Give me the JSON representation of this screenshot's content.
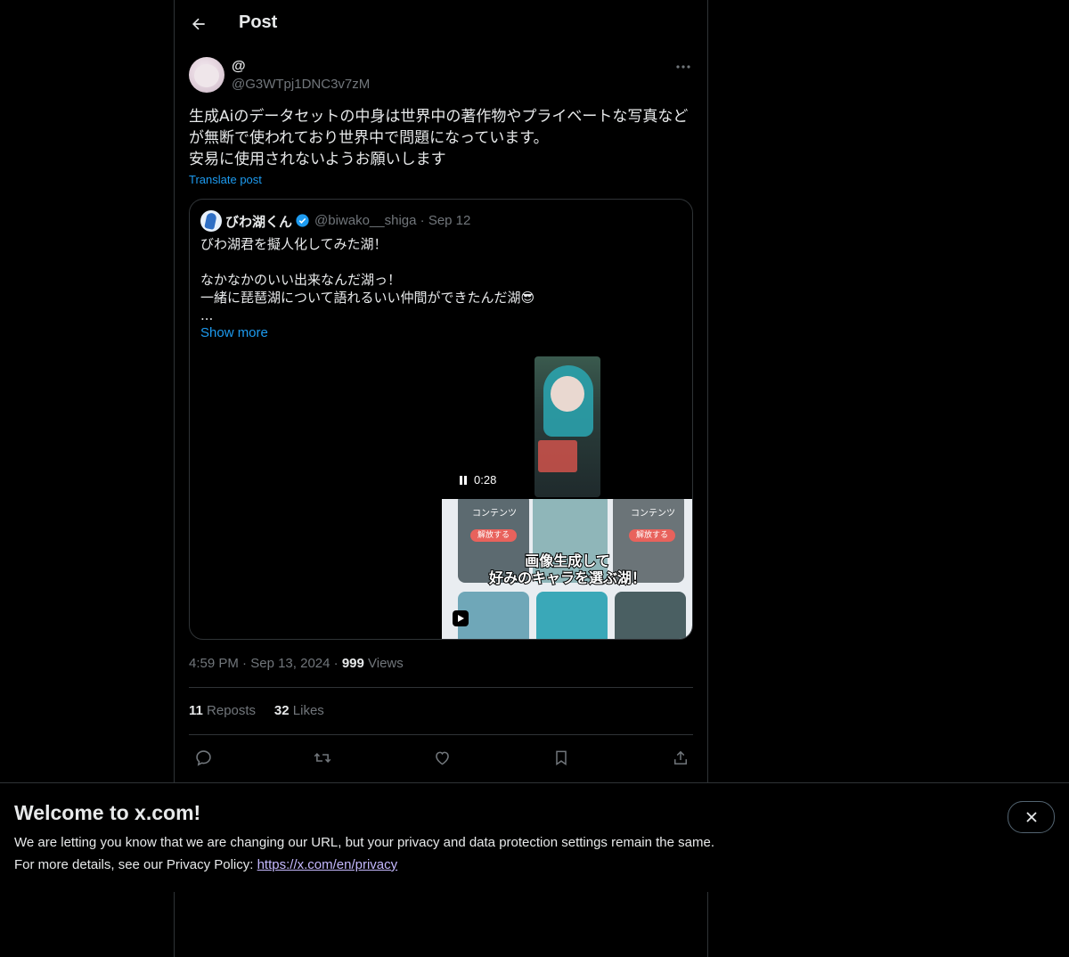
{
  "header": {
    "title": "Post"
  },
  "post": {
    "display_name": "@",
    "handle": "@G3WTpj1DNC3v7zM",
    "text": "生成Aiのデータセットの中身は世界中の著作物やプライベートな写真など\nが無断で使われており世界中で問題になっています。\n安易に使用されないようお願いします",
    "translate_label": "Translate post",
    "time": "4:59 PM",
    "date": "Sep 13, 2024",
    "views_count": "999",
    "views_label": "Views",
    "reposts_count": "11",
    "reposts_label": "Reposts",
    "likes_count": "32",
    "likes_label": "Likes"
  },
  "quote": {
    "display_name": "びわ湖くん",
    "handle": "@biwako__shiga",
    "date": "Sep 12",
    "text": "びわ湖君を擬人化してみた湖！\n\nなかなかのいい出来なんだ湖っ！\n一緒に琵琶湖について語れるいい仲間ができたんだ湖😎\n...",
    "show_more": "Show more",
    "video_time": "0:28",
    "thumbnail": {
      "label_left": "コンテンツ",
      "label_right": "コンテンツ",
      "button_left": "解放する",
      "button_right": "解放する",
      "banner_line1": "画像生成して",
      "banner_line2": "好みのキャラを選ぶ湖！"
    }
  },
  "banner": {
    "title": "Welcome to x.com!",
    "line1": "We are letting you know that we are changing our URL, but your privacy and data protection settings remain the same.",
    "line2_prefix": "For more details, see our Privacy Policy: ",
    "link": "https://x.com/en/privacy"
  },
  "icons": {
    "back": "arrow-left-icon",
    "more": "more-horizontal-icon",
    "verified": "verified-badge-icon",
    "reply": "reply-icon",
    "repost": "repost-icon",
    "like": "heart-icon",
    "bookmark": "bookmark-icon",
    "share": "share-icon",
    "close": "close-icon",
    "pause": "pause-icon",
    "play": "play-icon"
  },
  "colors": {
    "accent": "#1d9bf0",
    "background": "#000000",
    "muted": "#71767b",
    "border": "#2f3336",
    "link": "#c5b9ff"
  }
}
